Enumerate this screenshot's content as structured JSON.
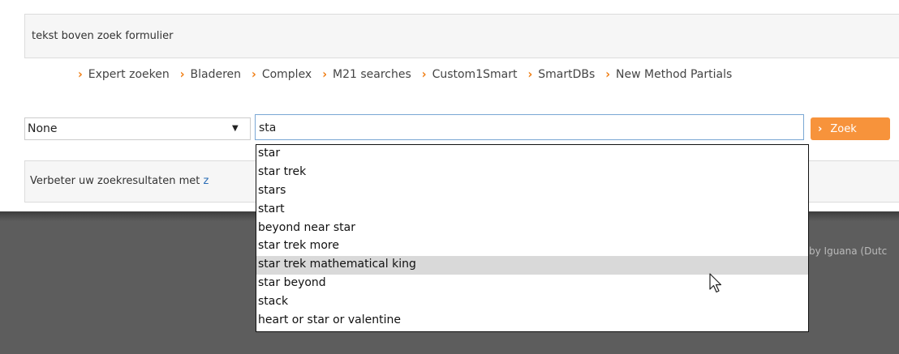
{
  "header": {
    "text": "tekst boven zoek formulier"
  },
  "nav": {
    "items": [
      {
        "label": "Expert zoeken"
      },
      {
        "label": "Bladeren"
      },
      {
        "label": "Complex"
      },
      {
        "label": "M21 searches"
      },
      {
        "label": "Custom1Smart"
      },
      {
        "label": "SmartDBs"
      },
      {
        "label": "New Method Partials"
      }
    ]
  },
  "search": {
    "select_value": "None",
    "query": "sta",
    "button_label": "Zoek"
  },
  "info": {
    "text": "Verbeter uw zoekresultaten met ",
    "link": "z"
  },
  "footer": {
    "credit": "by Iguana (Dutc"
  },
  "autocomplete": {
    "highlighted_index": 6,
    "suggestions": [
      "star",
      "star trek",
      "stars",
      "start",
      "beyond near star",
      "star trek more",
      "star trek mathematical king",
      "star beyond",
      "stack",
      "heart or star or valentine"
    ]
  },
  "colors": {
    "accent": "#f7933b",
    "chevron": "#f07d12",
    "link": "#2a6db6",
    "footer": "#5d5d5d",
    "highlight": "#d9d9d9"
  },
  "icons": {
    "nav_chevron": "chevron-right-icon",
    "select_arrow": "dropdown-arrow-icon",
    "cursor": "mouse-pointer-icon"
  }
}
